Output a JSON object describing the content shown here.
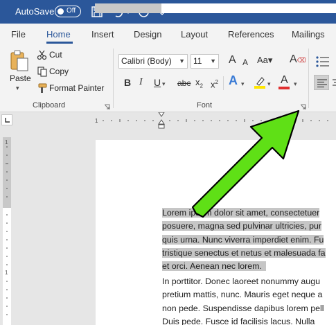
{
  "titlebar": {
    "autosave_label": "AutoSave",
    "autosave_state": "Off",
    "icons": [
      "save-icon",
      "undo-icon",
      "redo-icon",
      "customize-quick-access-icon"
    ]
  },
  "tabs": [
    "File",
    "Home",
    "Insert",
    "Design",
    "Layout",
    "References",
    "Mailings"
  ],
  "active_tab": "Home",
  "clipboard": {
    "paste_label": "Paste",
    "cut_label": "Cut",
    "copy_label": "Copy",
    "format_painter_label": "Format Painter",
    "group_label": "Clipboard"
  },
  "font": {
    "font_name": "Calibri (Body)",
    "font_size": "11",
    "group_label": "Font",
    "grow_shrink": "A",
    "bold": "B",
    "italic": "I",
    "underline": "U",
    "strikethrough": "abc",
    "subscript": "x",
    "superscript": "x",
    "text_effects": "A",
    "font_color": "A",
    "font_color_hex": "#e03030",
    "highlight_color_hex": "#ffe600"
  },
  "document": {
    "selected_lines": [
      "Lorem ipsum dolor sit amet, consectetuer",
      "posuere, magna sed pulvinar ultricies, pur",
      "quis urna. Nunc viverra imperdiet enim. Fu",
      "tristique senectus et netus et malesuada fa",
      "et orci. Aenean nec lorem."
    ],
    "lines": [
      "In porttitor. Donec laoreet nonummy augu",
      "pretium mattis, nunc. Mauris eget neque a",
      "non pede. Suspendisse dapibus lorem pell",
      "Duis pede. Fusce id facilisis lacus. Nulla"
    ]
  },
  "annotation": {
    "arrow_color": "#5fe016",
    "arrow_outline": "#000000"
  },
  "colors": {
    "title_bar": "#2b579a",
    "ribbon_bg": "#f3f3f3",
    "selection": "#c6c6c6"
  }
}
